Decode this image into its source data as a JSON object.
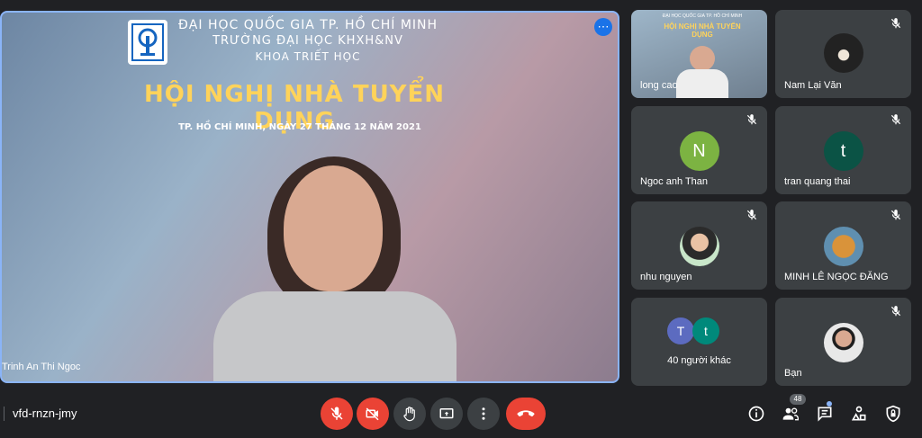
{
  "main": {
    "banner": {
      "line1": "ĐẠI HỌC QUỐC GIA TP. HỒ CHÍ MINH",
      "line2": "TRƯỜNG ĐẠI HỌC KHXH&NV",
      "line3": "KHOA TRIẾT HỌC",
      "title": "HỘI NGHỊ NHÀ TUYỂN DỤNG",
      "date_line": "TP. HỒ CHÍ MINH, NGÀY 27 THÁNG 12 NĂM 2021"
    },
    "speaker_name": "Trinh An Thi Ngoc",
    "more_icon": "more-vert-icon"
  },
  "participants": [
    {
      "name": "long cao",
      "type": "video",
      "muted": false
    },
    {
      "name": "Nam Lại Văn",
      "type": "photo",
      "muted": true
    },
    {
      "name": "Ngoc anh Than",
      "type": "initial",
      "initial": "N",
      "color": "#7cb342",
      "muted": true
    },
    {
      "name": "tran quang thai",
      "type": "initial",
      "initial": "t",
      "color": "#0b5345",
      "muted": true
    },
    {
      "name": "nhu nguyen",
      "type": "photo",
      "muted": true
    },
    {
      "name": "MINH LÊ NGỌC ĐĂNG",
      "type": "photo",
      "muted": true
    },
    {
      "name": "40 người khác",
      "type": "group",
      "initials": [
        "T",
        "t"
      ],
      "colors": [
        "#5c6bc0",
        "#00897b"
      ],
      "muted": false
    },
    {
      "name": "Bạn",
      "type": "photo",
      "muted": true
    }
  ],
  "bottom_bar": {
    "meeting_code": "vfd-rnzn-jmy",
    "participant_count": "48",
    "controls": [
      "mic-off-icon",
      "camera-off-icon",
      "raise-hand-icon",
      "present-screen-icon",
      "more-options-icon",
      "end-call-icon"
    ],
    "right_icons": [
      "info-icon",
      "people-icon",
      "chat-icon",
      "activities-icon",
      "host-controls-icon"
    ]
  },
  "colors": {
    "accent": "#8ab4f8",
    "danger": "#ea4335",
    "tile": "#3c4043",
    "bg": "#202124"
  }
}
